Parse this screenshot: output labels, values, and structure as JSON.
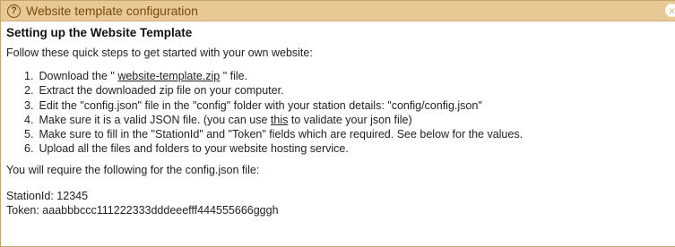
{
  "dialog": {
    "title": "Website template configuration",
    "help_icon_glyph": "?",
    "close_icon_glyph": "×"
  },
  "content": {
    "heading": "Setting up the Website Template",
    "intro": "Follow these quick steps to get started with your own website:",
    "steps": [
      {
        "num": "1.",
        "before": "Download the \" ",
        "link": "website-template.zip",
        "after": " \" file."
      },
      {
        "num": "2.",
        "text": "Extract the downloaded zip file on your computer."
      },
      {
        "num": "3.",
        "text": "Edit the \"config.json\" file in the \"config\" folder with your station details: \"config/config.json\""
      },
      {
        "num": "4.",
        "before": "Make sure it is a valid JSON file. (you can use ",
        "link": "this",
        "after": " to validate your json file)"
      },
      {
        "num": "5.",
        "text": "Make sure to fill in the \"StationId\" and \"Token\" fields which are required. See below for the values."
      },
      {
        "num": "6.",
        "text": "Upload all the files and folders to your website hosting service."
      }
    ],
    "require_text": "You will require the following for the config.json file:",
    "station_id_line": "StationId: 12345",
    "token_line": "Token: aaabbbccc111222333dddeeefff444555666gggh"
  }
}
